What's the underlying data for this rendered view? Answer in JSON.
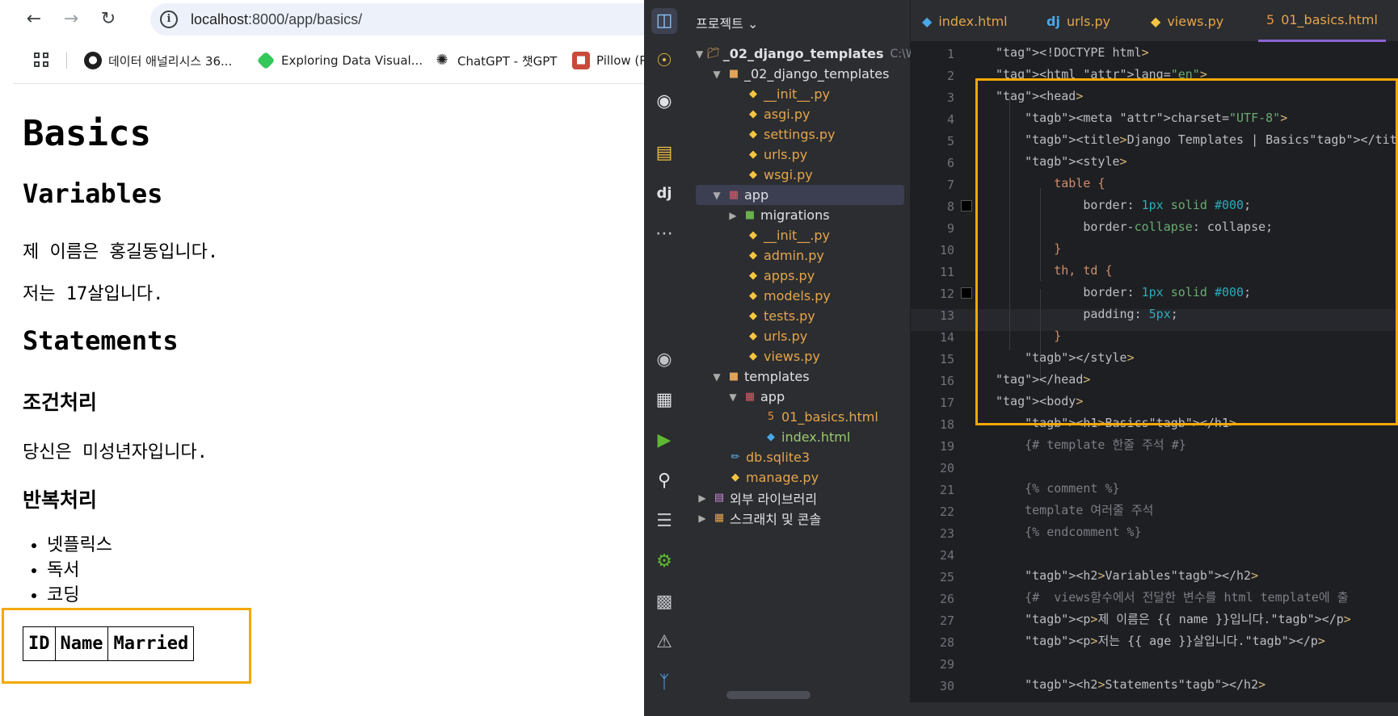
{
  "browser": {
    "url_host": "localhost",
    "url_path": ":8000/app/basics/",
    "bookmarks": [
      {
        "label": "데이터 애널리시스 36...",
        "icon": "github-icon"
      },
      {
        "label": "Exploring Data Visual...",
        "icon": "diamond-icon"
      },
      {
        "label": "ChatGPT - 챗GPT",
        "icon": "chatgpt-icon"
      },
      {
        "label": "Pillow (P",
        "icon": "pillow-icon"
      }
    ],
    "page": {
      "h1": "Basics",
      "variables_heading": "Variables",
      "name_line": "제 이름은 홍길동입니다.",
      "age_line": "저는 17살입니다.",
      "statements_heading": "Statements",
      "condition_heading": "조건처리",
      "condition_text": "당신은 미성년자입니다.",
      "loop_heading": "반복처리",
      "hobbies": [
        "넷플릭스",
        "독서",
        "코딩"
      ],
      "table_headers": [
        "ID",
        "Name",
        "Married"
      ]
    }
  },
  "ide": {
    "project_label": "프로젝트",
    "tabs": [
      {
        "label": "index.html",
        "icon": "django-template-icon"
      },
      {
        "label": "urls.py",
        "icon": "django-icon"
      },
      {
        "label": "views.py",
        "icon": "python-icon"
      },
      {
        "label": "01_basics.html",
        "icon": "html5-icon"
      }
    ],
    "tree": {
      "root": "_02_django_templates",
      "root_path": "C:\\Wo",
      "pkg": "_02_django_templates",
      "pkg_files": [
        "__init__.py",
        "asgi.py",
        "settings.py",
        "urls.py",
        "wsgi.py"
      ],
      "app": "app",
      "migrations": "migrations",
      "app_files": [
        "__init__.py",
        "admin.py",
        "apps.py",
        "models.py",
        "tests.py",
        "urls.py",
        "views.py"
      ],
      "templates": "templates",
      "templates_app": "app",
      "template_files": [
        "01_basics.html",
        "index.html"
      ],
      "db": "db.sqlite3",
      "manage": "manage.py",
      "external_libs": "외부 라이브러리",
      "scratches": "스크래치 및 콘솔"
    },
    "code_lines": [
      "<!DOCTYPE html>",
      "<html lang=\"en\">",
      "<head>",
      "    <meta charset=\"UTF-8\">",
      "    <title>Django Templates | Basics</title>",
      "    <style>",
      "        table {",
      "            border: 1px solid #000;",
      "            border-collapse: collapse;",
      "        }",
      "        th, td {",
      "            border: 1px solid #000;",
      "            padding: 5px;",
      "        }",
      "    </style>",
      "</head>",
      "<body>",
      "    <h1>Basics</h1>",
      "    {# template 한줄 주석 #}",
      "",
      "    {% comment %}",
      "    template 여러줄 주석",
      "    {% endcomment %}",
      "",
      "    <h2>Variables</h2>",
      "    {#  views함수에서 전달한 변수를 html template에 출",
      "    <p>제 이름은 {{ name }}입니다.</p>",
      "    <p>저는 {{ age }}살입니다.</p>",
      "",
      "    <h2>Statements</h2>"
    ]
  }
}
